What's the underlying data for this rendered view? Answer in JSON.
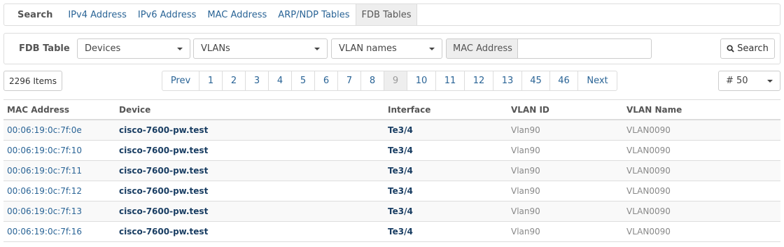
{
  "nav": {
    "brand": "Search",
    "tabs": [
      "IPv4 Address",
      "IPv6 Address",
      "MAC Address",
      "ARP/NDP Tables",
      "FDB Tables"
    ],
    "active_tab": "FDB Tables"
  },
  "filter": {
    "label": "FDB Table",
    "devices": "Devices",
    "vlans": "VLANs",
    "vlan_names": "VLAN names",
    "mac_addon": "MAC Address",
    "mac_value": "",
    "search_button": "Search"
  },
  "pagination": {
    "count": "2296 Items",
    "pages": [
      "Prev",
      "1",
      "2",
      "3",
      "4",
      "5",
      "6",
      "7",
      "8",
      "9",
      "10",
      "11",
      "12",
      "13",
      "45",
      "46",
      "Next"
    ],
    "active": "9",
    "per_page": "# 50"
  },
  "table": {
    "headers": [
      "MAC Address",
      "Device",
      "Interface",
      "VLAN ID",
      "VLAN Name"
    ],
    "rows": [
      {
        "mac": "00:06:19:0c:7f:0e",
        "device": "cisco-7600-pw.test",
        "interface": "Te3/4",
        "vlan_id": "Vlan90",
        "vlan_name": "VLAN0090"
      },
      {
        "mac": "00:06:19:0c:7f:10",
        "device": "cisco-7600-pw.test",
        "interface": "Te3/4",
        "vlan_id": "Vlan90",
        "vlan_name": "VLAN0090"
      },
      {
        "mac": "00:06:19:0c:7f:11",
        "device": "cisco-7600-pw.test",
        "interface": "Te3/4",
        "vlan_id": "Vlan90",
        "vlan_name": "VLAN0090"
      },
      {
        "mac": "00:06:19:0c:7f:12",
        "device": "cisco-7600-pw.test",
        "interface": "Te3/4",
        "vlan_id": "Vlan90",
        "vlan_name": "VLAN0090"
      },
      {
        "mac": "00:06:19:0c:7f:13",
        "device": "cisco-7600-pw.test",
        "interface": "Te3/4",
        "vlan_id": "Vlan90",
        "vlan_name": "VLAN0090"
      },
      {
        "mac": "00:06:19:0c:7f:16",
        "device": "cisco-7600-pw.test",
        "interface": "Te3/4",
        "vlan_id": "Vlan90",
        "vlan_name": "VLAN0090"
      }
    ]
  },
  "colors": {
    "link": "#2a6496",
    "bold_link": "#1a3e63",
    "border": "#dddddd",
    "active_bg": "#eeeeee"
  },
  "icons": {
    "search": "search-icon",
    "caret": "caret-down-icon"
  }
}
